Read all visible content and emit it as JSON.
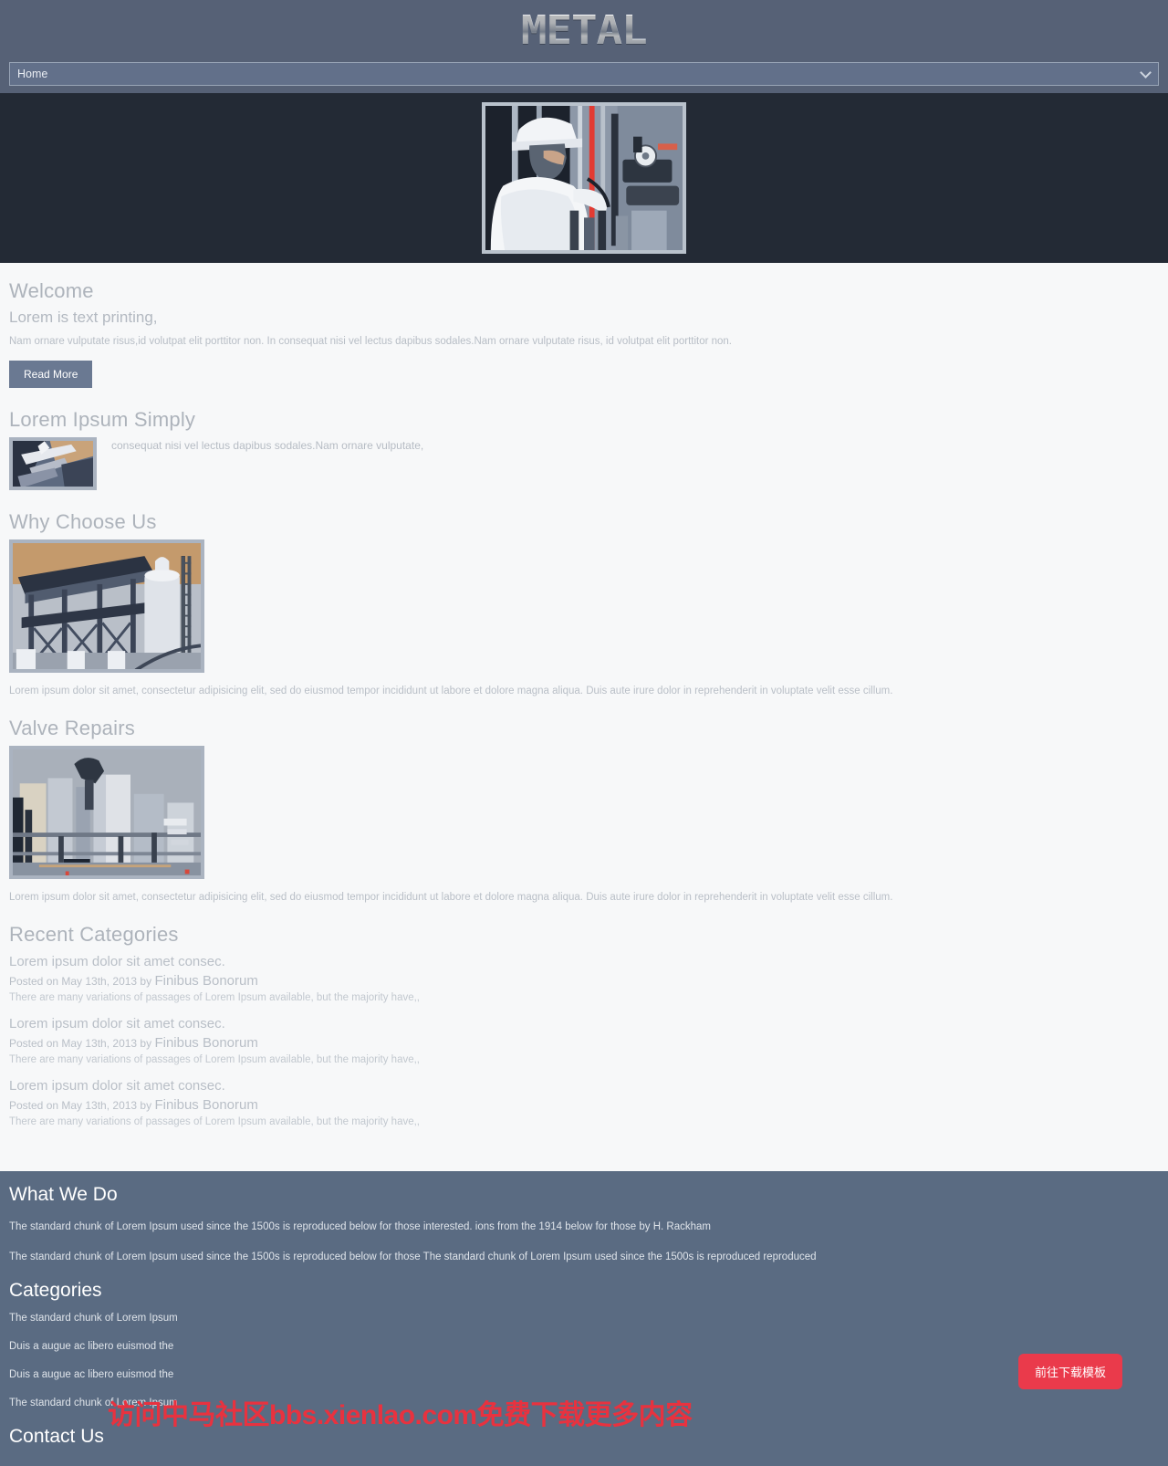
{
  "header": {
    "logo_text": "METAL"
  },
  "nav": {
    "selected": "Home",
    "options": [
      "Home"
    ],
    "chevron_icon": "chevron-down-icon"
  },
  "hero": {
    "image_alt": "industrial worker in hard hat adjusting valves and pressure gauge"
  },
  "main": {
    "welcome": {
      "title": "Welcome",
      "lead": "Lorem is text printing,",
      "body": "Nam ornare vulputate risus,id volutpat elit porttitor non. In consequat nisi vel lectus dapibus sodales.Nam ornare vulputate risus, id volutpat elit porttitor non.",
      "button_label": "Read More"
    },
    "lorem_simply": {
      "title": "Lorem Ipsum Simply",
      "text": "consequat nisi vel lectus dapibus sodales.Nam ornare vulputate,",
      "image_alt": "metal fabrication close-up"
    },
    "why_choose": {
      "title": "Why Choose Us",
      "image_alt": "industrial plant with steel framework and silo",
      "caption": "Lorem ipsum dolor sit amet, consectetur adipisicing elit, sed do eiusmod tempor incididunt ut labore et dolore magna aliqua. Duis aute irure dolor in reprehenderit in voluptate velit esse cillum."
    },
    "valve_repairs": {
      "title": "Valve Repairs",
      "image_alt": "refinery storage tanks and pipework",
      "caption": "Lorem ipsum dolor sit amet, consectetur adipisicing elit, sed do eiusmod tempor incididunt ut labore et dolore magna aliqua. Duis aute irure dolor in reprehenderit in voluptate velit esse cillum."
    },
    "recent": {
      "title": "Recent Categories",
      "posts": [
        {
          "title": "Lorem ipsum dolor sit amet consec.",
          "meta_prefix": "Posted on May 13th, 2013 by",
          "author": "Finibus Bonorum",
          "excerpt": "There are many variations of passages of Lorem Ipsum available, but the majority have,,"
        },
        {
          "title": "Lorem ipsum dolor sit amet consec.",
          "meta_prefix": "Posted on May 13th, 2013 by",
          "author": "Finibus Bonorum",
          "excerpt": "There are many variations of passages of Lorem Ipsum available, but the majority have,,"
        },
        {
          "title": "Lorem ipsum dolor sit amet consec.",
          "meta_prefix": "Posted on May 13th, 2013 by",
          "author": "Finibus Bonorum",
          "excerpt": "There are many variations of passages of Lorem Ipsum available, but the majority have,,"
        }
      ]
    }
  },
  "footer": {
    "what_we_do_title": "What We Do",
    "paragraph1": "The standard chunk of Lorem Ipsum used since the 1500s is reproduced below for those interested. ions from the 1914 below for those by H. Rackham",
    "paragraph2": "The standard chunk of Lorem Ipsum used since the 1500s is reproduced below for those The standard chunk of Lorem Ipsum used since the 1500s is reproduced reproduced",
    "categories_title": "Categories",
    "categories": [
      "The standard chunk of Lorem Ipsum",
      "Duis a augue ac libero euismod the",
      "Duis a augue ac libero euismod the",
      "The standard chunk of Lorem Ipsum"
    ],
    "contact_title": "Contact Us",
    "cta_label": "前往下载模板"
  },
  "watermark": {
    "text": "访问中马社区bbs.xienlao.com免费下载更多内容"
  },
  "colors": {
    "header_bg": "#566176",
    "hero_bg": "#232a35",
    "footer_bg": "#5a6b82",
    "accent_red": "#ea3a4b",
    "button_bg": "#6a7992"
  }
}
